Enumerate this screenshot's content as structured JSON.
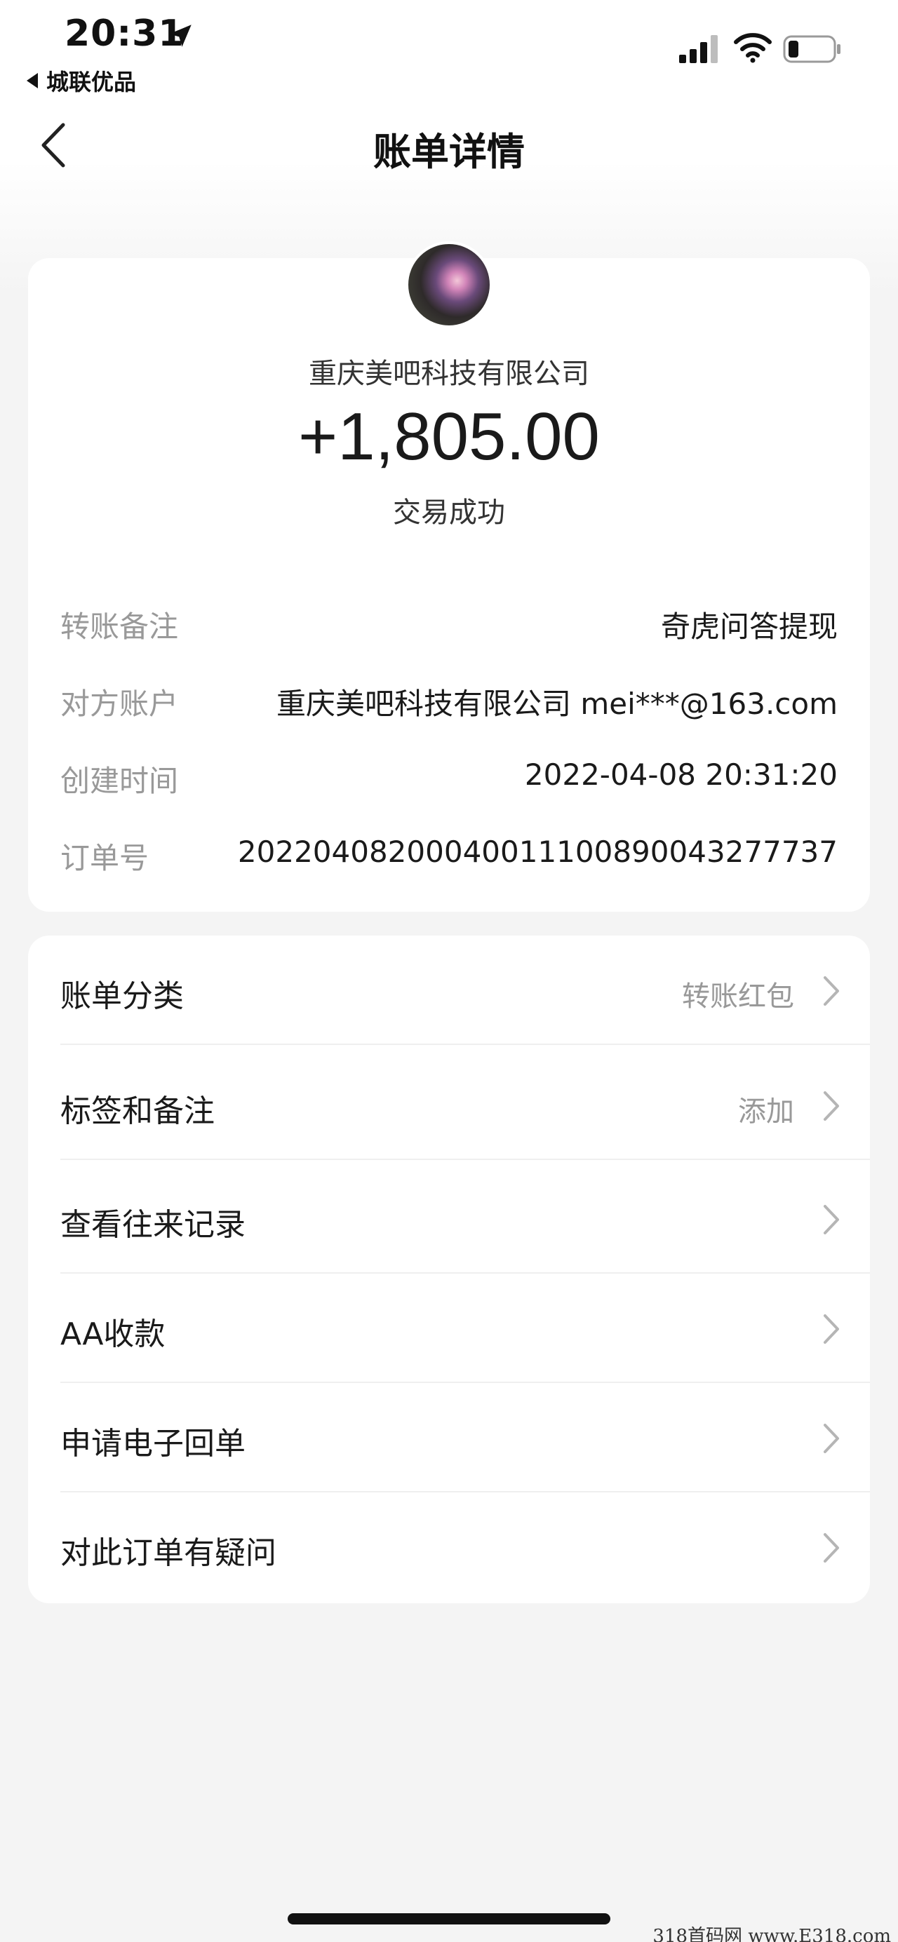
{
  "status_bar": {
    "time": "20:31",
    "back_app_label": "城联优品"
  },
  "nav": {
    "title": "账单详情"
  },
  "transaction": {
    "merchant_name": "重庆美吧科技有限公司",
    "amount": "+1,805.00",
    "status": "交易成功"
  },
  "details": [
    {
      "label": "转账备注",
      "value": "奇虎问答提现"
    },
    {
      "label": "对方账户",
      "value": "重庆美吧科技有限公司 mei***@163.com"
    },
    {
      "label": "创建时间",
      "value": "2022-04-08 20:31:20"
    },
    {
      "label": "订单号",
      "value": "20220408200040011100890043277737"
    }
  ],
  "menu": [
    {
      "label": "账单分类",
      "value": "转账红包"
    },
    {
      "label": "标签和备注",
      "value": "添加"
    },
    {
      "label": "查看往来记录",
      "value": ""
    },
    {
      "label": "AA收款",
      "value": ""
    },
    {
      "label": "申请电子回单",
      "value": ""
    },
    {
      "label": "对此订单有疑问",
      "value": ""
    }
  ],
  "watermark": "318首码网 www.E318.com",
  "colors": {
    "background": "#f4f4f4",
    "card": "#ffffff",
    "label_gray": "#999999",
    "text": "#1a1a1a"
  }
}
